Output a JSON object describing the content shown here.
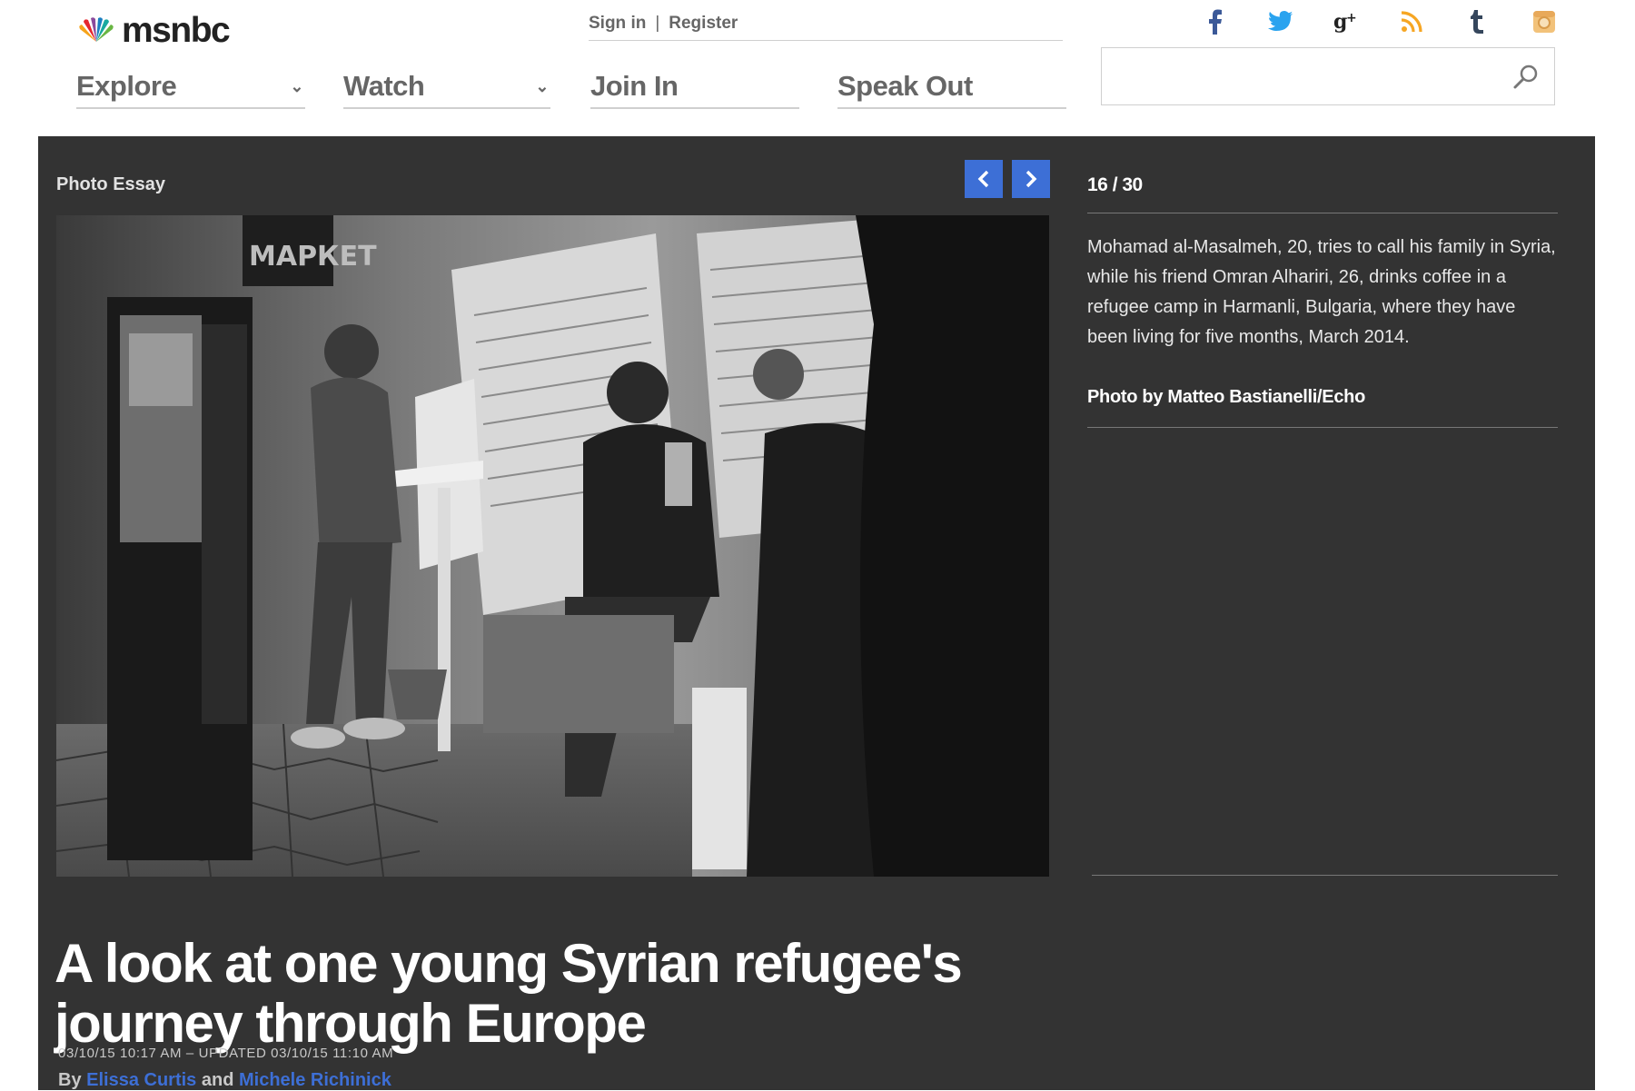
{
  "header": {
    "brand": "msnbc",
    "auth": {
      "sign_in": "Sign in",
      "separator": "|",
      "register": "Register"
    },
    "social": [
      "facebook-icon",
      "twitter-icon",
      "google-plus-icon",
      "rss-icon",
      "tumblr-icon",
      "instagram-icon"
    ],
    "nav": [
      {
        "label": "Explore",
        "dropdown": true
      },
      {
        "label": "Watch",
        "dropdown": true
      },
      {
        "label": "Join In",
        "dropdown": false
      },
      {
        "label": "Speak Out",
        "dropdown": false
      }
    ],
    "search": {
      "value": "",
      "placeholder": ""
    }
  },
  "gallery": {
    "section_label": "Photo Essay",
    "counter": "16 / 30",
    "caption": "Mohamad al-Masalmeh, 20, tries to call his family in Syria, while his friend Omran Alhariri, 26, drinks coffee in a refugee camp in Harmanli, Bulgaria, where they have been living for five months, March 2014.",
    "credit": "Photo by Matteo Bastianelli/Echo",
    "photo_sign": "МАРКЕТ"
  },
  "article": {
    "headline": "A look at one young Syrian refugee's journey through Europe",
    "timestamp": "03/10/15 10:17 AM – UPDATED 03/10/15 11:10 AM",
    "byline_prefix": "By",
    "author_1": "Elissa Curtis",
    "byline_joiner": "and",
    "author_2": "Michele Richinick"
  },
  "colors": {
    "panel_bg": "#333333",
    "accent_blue": "#3d6fd6",
    "facebook": "#3b5998",
    "twitter": "#2aa3ef",
    "rss": "#f6a623",
    "tumblr": "#35465c",
    "instagram": "#f2c27a"
  }
}
